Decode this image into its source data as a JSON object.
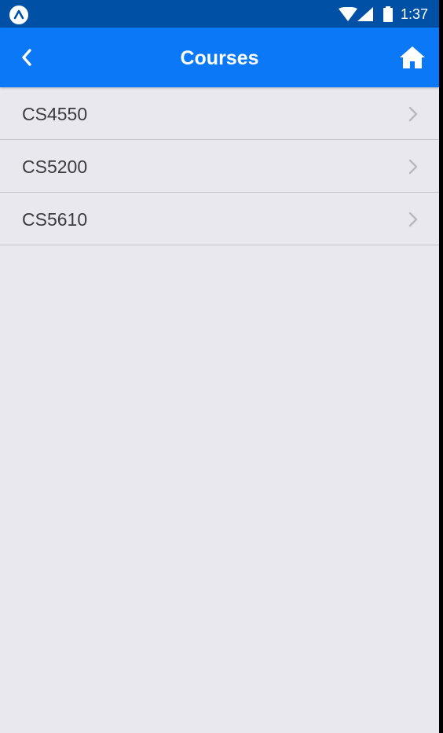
{
  "status_bar": {
    "time": "1:37",
    "icons": [
      "app-badge-icon",
      "wifi-icon",
      "signal-icon",
      "battery-icon"
    ]
  },
  "header": {
    "title": "Courses",
    "back_icon": "chevron-left-icon",
    "home_icon": "home-icon"
  },
  "courses": [
    {
      "label": "CS4550"
    },
    {
      "label": "CS5200"
    },
    {
      "label": "CS5610"
    }
  ],
  "colors": {
    "status_bar": "#0050a6",
    "header": "#0a78f7",
    "background": "#e9e8ef",
    "divider": "#c4c3c9",
    "chevron": "#b9b8bf"
  }
}
